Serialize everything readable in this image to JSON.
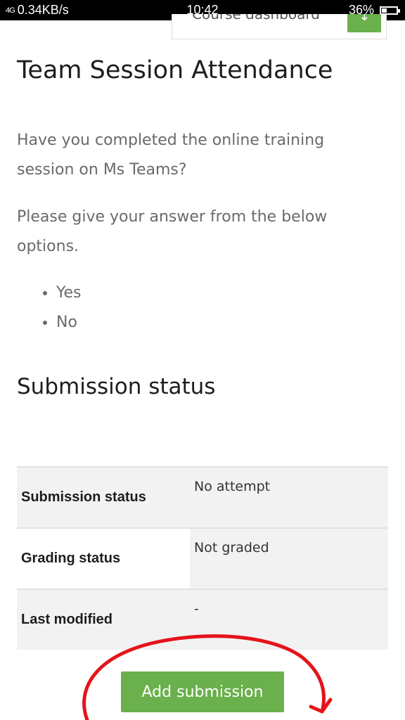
{
  "statusbar": {
    "signal": "4G",
    "speed": "0.34KB/s",
    "time": "10:42",
    "battery": "36%"
  },
  "header": {
    "course_dashboard_label": "Course dashboard",
    "arrow_icon": "arrow-icon"
  },
  "main": {
    "title": "Team Session Attendance",
    "question": "Have you completed the online training session on Ms Teams?",
    "instruction": "Please give your answer from the below options.",
    "options": [
      "Yes",
      "No"
    ]
  },
  "submission": {
    "heading": "Submission status",
    "rows": [
      {
        "label": "Submission status",
        "value": "No attempt"
      },
      {
        "label": "Grading status",
        "value": "Not graded"
      },
      {
        "label": "Last modified",
        "value": "-"
      }
    ],
    "add_button_label": "Add submission"
  },
  "colors": {
    "accent_green": "#6ab04c",
    "annotation_red": "#e4141b"
  }
}
